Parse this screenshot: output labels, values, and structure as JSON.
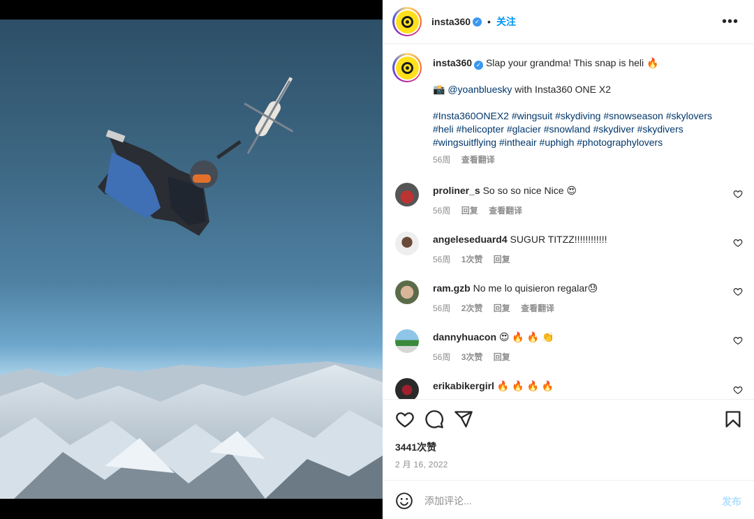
{
  "colors": {
    "accent": "#0095f6",
    "link": "#00376b",
    "muted": "#8e8e8e",
    "verified": "#3897f0",
    "brand_yellow": "#ffe01b"
  },
  "header": {
    "username": "insta360",
    "separator": "•",
    "follow_label": "关注",
    "more_label": "•••"
  },
  "caption": {
    "username": "insta360",
    "text": "Slap your grandma! This snap is heli 🔥",
    "credit_emoji": "📸",
    "credit_mention": "@yoanbluesky",
    "credit_text": " with Insta360 ONE X2",
    "hashtags": "#Insta360ONEX2 #wingsuit #skydiving #snowseason #skylovers #heli #helicopter #glacier #snowland #skydiver #skydivers #wingsuitflying #intheair #uphigh #photographylovers",
    "time": "56周",
    "translate": "查看翻译"
  },
  "comments": [
    {
      "username": "proliner_s",
      "text": "So so so nice Nice 😍",
      "time": "56周",
      "likes": "",
      "reply": "回复",
      "translate": "查看翻译"
    },
    {
      "username": "angeleseduard4",
      "text": "SUGUR TITZZ!!!!!!!!!!!!",
      "time": "56周",
      "likes": "1次赞",
      "reply": "回复",
      "translate": ""
    },
    {
      "username": "ram.gzb",
      "text": "No me lo quisieron regalar😓",
      "time": "56周",
      "likes": "2次赞",
      "reply": "回复",
      "translate": "查看翻译"
    },
    {
      "username": "dannyhuacon",
      "text": "😍 🔥 🔥 👏",
      "time": "56周",
      "likes": "3次赞",
      "reply": "回复",
      "translate": ""
    },
    {
      "username": "erikabikergirl",
      "text": "🔥 🔥 🔥 🔥",
      "time": "",
      "likes": "",
      "reply": "",
      "translate": ""
    }
  ],
  "likes_count": "3441次赞",
  "post_date": "2 月 16, 2022",
  "add_comment": {
    "placeholder": "添加评论...",
    "post_label": "发布"
  },
  "icons": [
    "heart-icon",
    "comment-icon",
    "share-icon",
    "bookmark-icon",
    "emoji-icon",
    "more-icon",
    "verified-icon"
  ]
}
